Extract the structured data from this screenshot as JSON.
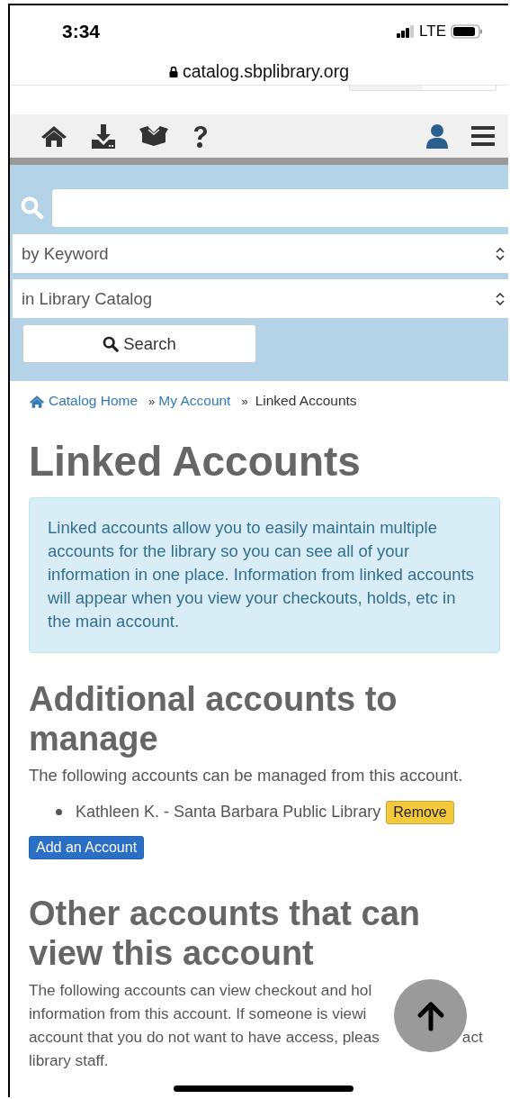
{
  "status_bar": {
    "time": "3:34",
    "network": "LTE"
  },
  "address_bar": {
    "url": "catalog.sbplibrary.org"
  },
  "search": {
    "type_select": "by Keyword",
    "scope_select": "in Library Catalog",
    "button": "Search"
  },
  "breadcrumbs": [
    {
      "label": "Catalog Home",
      "kind": "link"
    },
    {
      "label": "»",
      "kind": "sep"
    },
    {
      "label": "My Account",
      "kind": "link"
    },
    {
      "label": "»",
      "kind": "sep"
    },
    {
      "label": "Linked Accounts",
      "kind": "current"
    }
  ],
  "page_title": "Linked Accounts",
  "info_alert": "Linked accounts allow you to easily maintain multiple accounts for the library so you can see all of your information in one place. Information from linked accounts will appear when you view your checkouts, holds, etc in the main account.",
  "sections": [
    {
      "heading": "Additional accounts to manage",
      "text_lines": [
        [
          "The following accounts can be managed from this account."
        ]
      ],
      "items": [
        {
          "label": "Kathleen K. - Santa Barbara Public Library",
          "action": "Remove"
        }
      ],
      "button": "Add an Account"
    },
    {
      "heading": "Other accounts that can view this account",
      "text_lines": [
        [
          "The following accounts can view checkout and hol"
        ],
        [
          "information from this account. If someone is viewi"
        ],
        [
          "account that you do not want to have access, pleas",
          "act"
        ],
        [
          "library staff."
        ]
      ]
    }
  ]
}
